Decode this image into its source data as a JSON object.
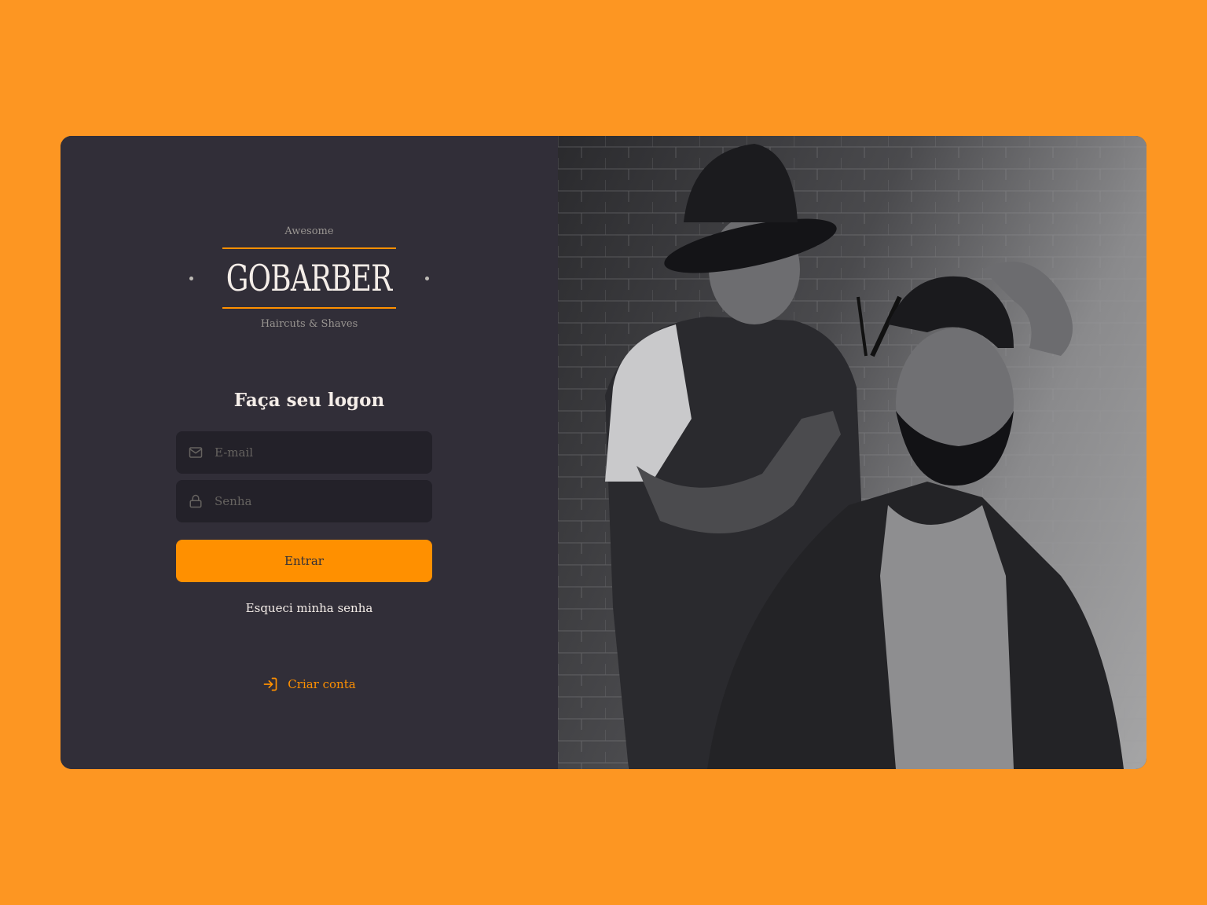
{
  "colors": {
    "background": "#fd9622",
    "panel": "#312e38",
    "input_bg": "#232129",
    "accent": "#ff9000",
    "text": "#f4ede8",
    "placeholder": "#666360"
  },
  "logo": {
    "top_text": "Awesome",
    "name": "GOBARBER",
    "bottom_text": "Haircuts & Shaves"
  },
  "form": {
    "title": "Faça seu logon",
    "email": {
      "placeholder": "E-mail",
      "value": "",
      "icon": "mail-icon"
    },
    "password": {
      "placeholder": "Senha",
      "value": "",
      "icon": "lock-icon"
    },
    "submit_label": "Entrar",
    "forgot_label": "Esqueci minha senha"
  },
  "create_account": {
    "label": "Criar conta",
    "icon": "log-in-icon"
  },
  "photo": {
    "description_icon": "barber-photo"
  }
}
